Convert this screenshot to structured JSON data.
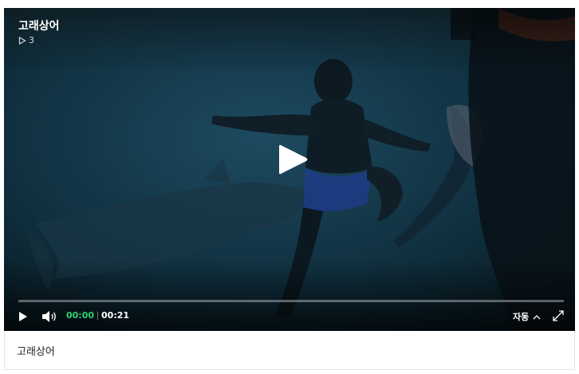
{
  "video": {
    "title": "고래상어",
    "view_count": "3",
    "view_icon": "play-outline-icon",
    "progress": 0.0
  },
  "controls": {
    "current_time": "00:00",
    "total_time": "00:21",
    "autoplay_label": "자동",
    "play_icon": "play-icon",
    "volume_icon": "volume-icon",
    "autoplay_icon": "chevron-up-icon",
    "fullscreen_icon": "expand-icon",
    "current_time_color": "#2fd46f"
  },
  "caption": {
    "text": "고래상어"
  }
}
